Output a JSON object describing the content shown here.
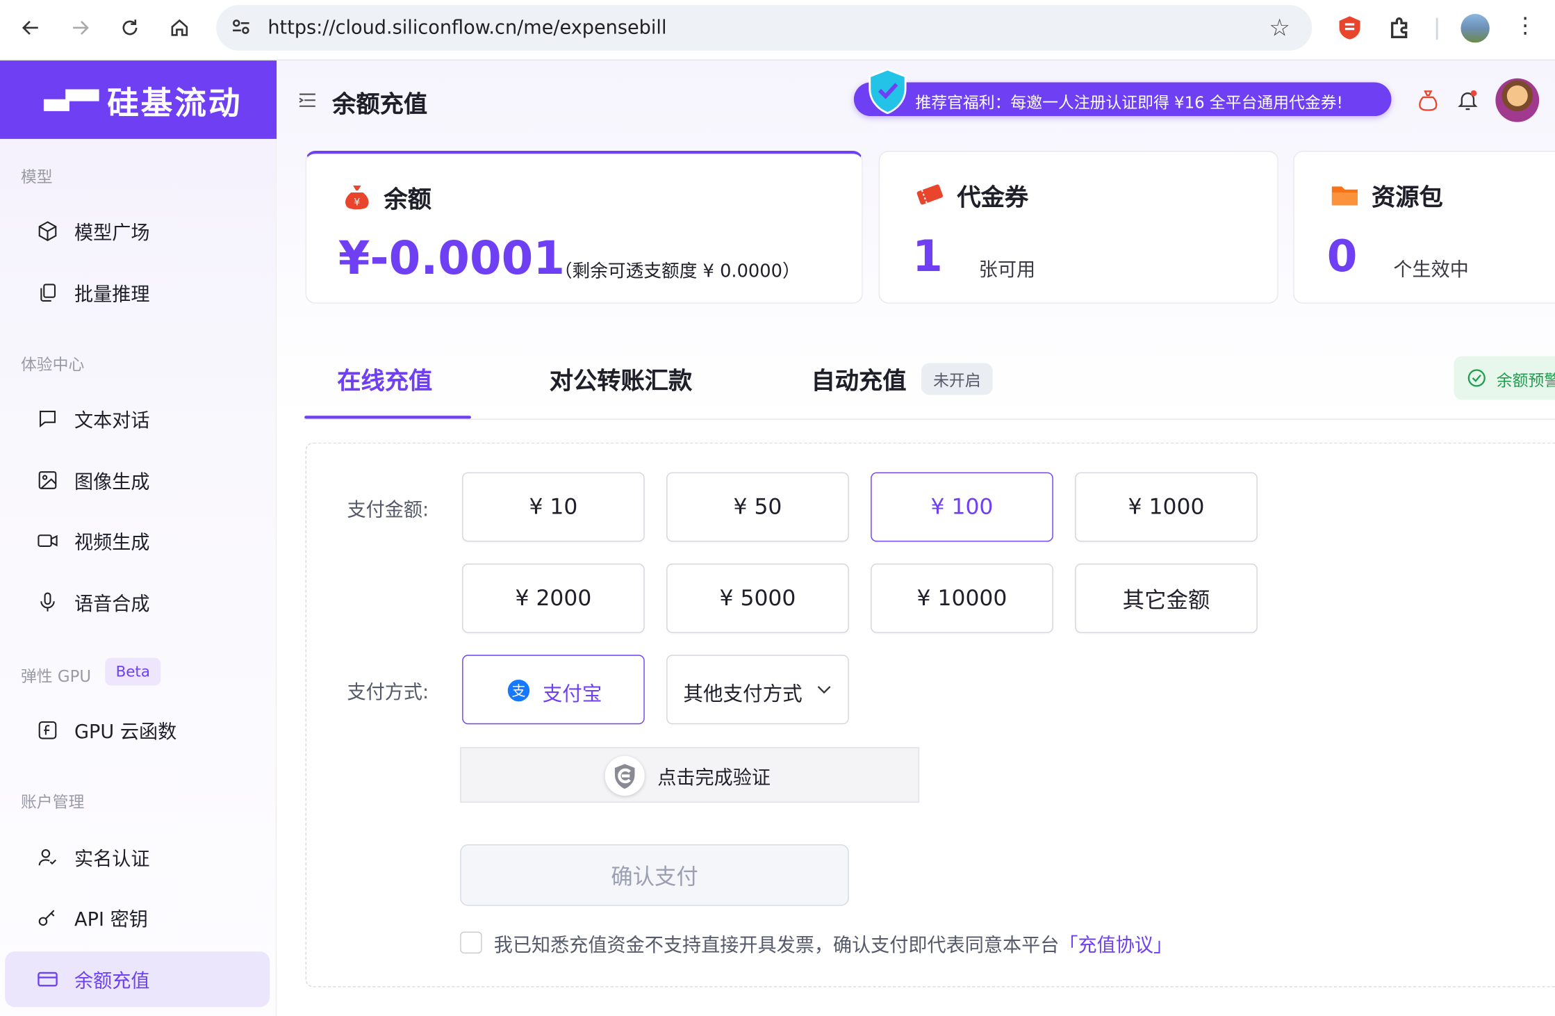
{
  "browser": {
    "url": "https://cloud.siliconflow.cn/me/expensebill"
  },
  "brand": {
    "name": "硅基流动",
    "accent": "#6e3ff3"
  },
  "sidebar": {
    "sections": [
      {
        "title": "模型"
      },
      {
        "title": "体验中心"
      },
      {
        "title": "弹性 GPU",
        "badge": "Beta"
      },
      {
        "title": "账户管理"
      }
    ],
    "items": [
      {
        "label": "模型广场",
        "icon": "cube-icon"
      },
      {
        "label": "批量推理",
        "icon": "copy-icon"
      },
      {
        "label": "文本对话",
        "icon": "chat-icon"
      },
      {
        "label": "图像生成",
        "icon": "image-icon"
      },
      {
        "label": "视频生成",
        "icon": "video-icon"
      },
      {
        "label": "语音合成",
        "icon": "microphone-icon"
      },
      {
        "label": "GPU 云函数",
        "icon": "function-icon"
      },
      {
        "label": "实名认证",
        "icon": "user-check-icon"
      },
      {
        "label": "API 密钥",
        "icon": "key-icon"
      },
      {
        "label": "余额充值",
        "icon": "wallet-icon",
        "active": true
      }
    ]
  },
  "header": {
    "title": "余额充值",
    "promo": "推荐官福利：每邀一人注册认证即得 ¥16 全平台通用代金券!"
  },
  "cards": {
    "balance": {
      "title": "余额",
      "value": "¥-0.0001",
      "note": "（剩余可透支额度 ¥ 0.0000）"
    },
    "voucher": {
      "title": "代金券",
      "count": "1",
      "label": "张可用"
    },
    "package": {
      "title": "资源包",
      "count": "0",
      "label": "个生效中"
    }
  },
  "tabs": [
    {
      "label": "在线充值",
      "active": true
    },
    {
      "label": "对公转账汇款"
    },
    {
      "label": "自动充值",
      "tag": "未开启"
    }
  ],
  "warning_pill": "余额预警",
  "form": {
    "amount_label": "支付金额:",
    "amounts": [
      "¥ 10",
      "¥ 50",
      "¥ 100",
      "¥ 1000",
      "¥ 2000",
      "¥ 5000",
      "¥ 10000",
      "其它金额"
    ],
    "selected_amount": "¥ 100",
    "method_label": "支付方式:",
    "alipay": "支付宝",
    "other_methods": "其他支付方式",
    "captcha": "点击完成验证",
    "confirm": "确认支付",
    "agreement_text": "我已知悉充值资金不支持直接开具发票，确认支付即代表同意本平台",
    "agreement_link": "「充值协议」"
  }
}
